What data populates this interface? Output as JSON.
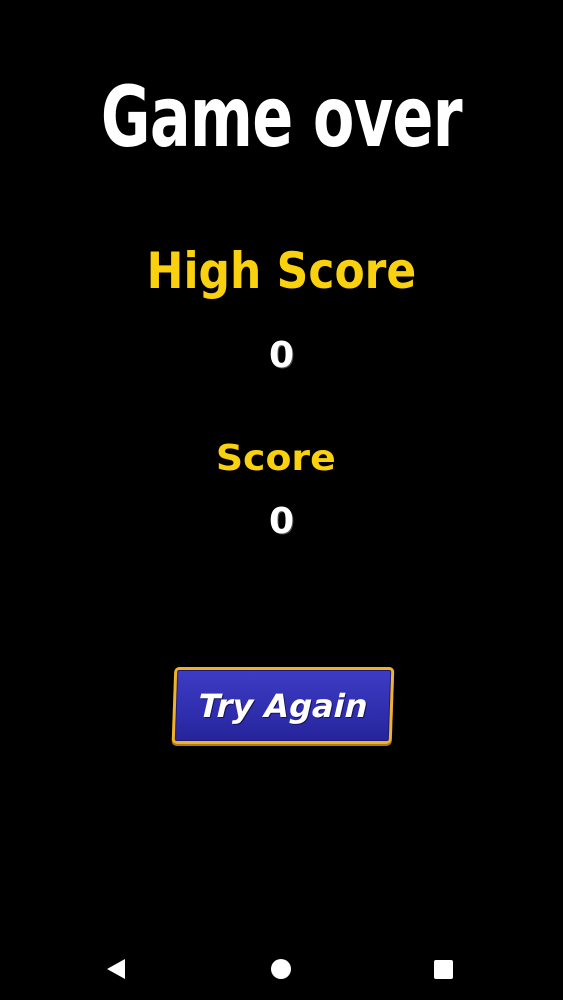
{
  "game_over": {
    "title": "Game over",
    "high_score_label": "High Score",
    "high_score_value": "0",
    "score_label": "Score",
    "score_value": "0",
    "try_again_label": "Try Again"
  },
  "colors": {
    "background": "#000000",
    "title": "#ffffff",
    "label_yellow": "#f9d10f",
    "button_fill": "#2f2eae",
    "button_border": "#f0b22a"
  },
  "navbar": {
    "icons": [
      "back-icon",
      "home-icon",
      "recent-apps-icon"
    ]
  }
}
